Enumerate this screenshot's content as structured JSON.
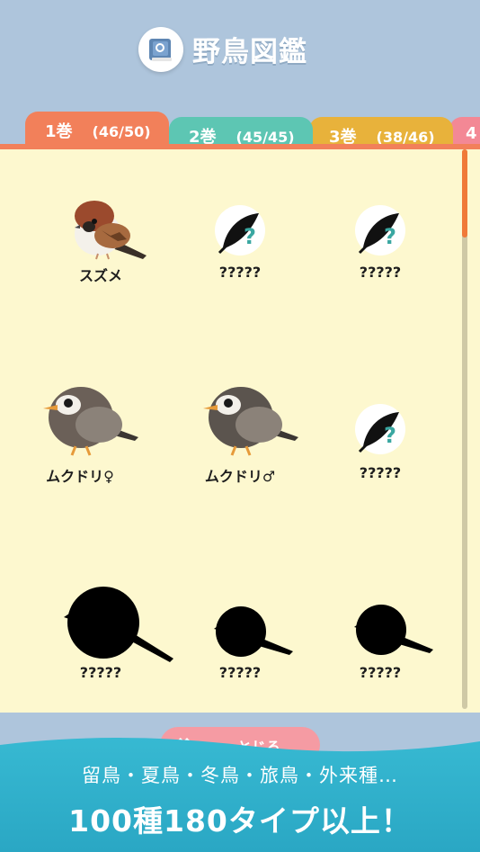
{
  "header": {
    "title": "野鳥図鑑",
    "icon": "book-icon"
  },
  "tabs": [
    {
      "label": "1巻",
      "count": "(46/50)",
      "color": "#f2805a",
      "active": true
    },
    {
      "label": "2巻",
      "count": "(45/45)",
      "color": "#5dc6b3",
      "active": false
    },
    {
      "label": "3巻",
      "count": "(38/46)",
      "color": "#e8b23b",
      "active": false
    },
    {
      "label": "4",
      "count": "",
      "color": "#f38895",
      "active": false
    }
  ],
  "entries": [
    {
      "name": "スズメ",
      "state": "sparrow"
    },
    {
      "name": "?????",
      "state": "unknown"
    },
    {
      "name": "?????",
      "state": "unknown"
    },
    {
      "name": "ムクドリ♀",
      "state": "starling"
    },
    {
      "name": "ムクドリ♂",
      "state": "starling"
    },
    {
      "name": "?????",
      "state": "unknown"
    },
    {
      "name": "?????",
      "state": "silhouette"
    },
    {
      "name": "?????",
      "state": "silhouette"
    },
    {
      "name": "?????",
      "state": "silhouette"
    }
  ],
  "close_button": {
    "label": "とじる"
  },
  "promo": {
    "subtitle": "留鳥・夏鳥・冬鳥・旅鳥・外来種…",
    "headline": "100種180タイプ以上！"
  }
}
